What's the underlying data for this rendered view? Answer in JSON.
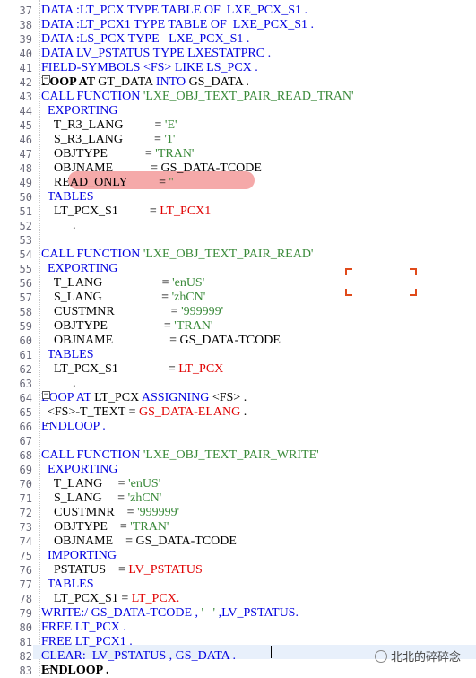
{
  "editor": {
    "lines": [
      {
        "n": "37",
        "tokens": [
          {
            "t": "DATA :LT_PCX TYPE TABLE OF  LXE_PCX_S1 .",
            "c": "bl"
          }
        ]
      },
      {
        "n": "38",
        "tokens": [
          {
            "t": "DATA :LT_PCX1 TYPE TABLE OF  LXE_PCX_S1 .",
            "c": "bl"
          }
        ]
      },
      {
        "n": "39",
        "tokens": [
          {
            "t": "DATA :LS_PCX TYPE   LXE_PCX_S1 .",
            "c": "bl"
          }
        ]
      },
      {
        "n": "40",
        "tokens": [
          {
            "t": "DATA LV_PSTATUS TYPE LXESTATPRC .",
            "c": "bl"
          }
        ]
      },
      {
        "n": "41",
        "tokens": [
          {
            "t": "FIELD-SYMBOLS <FS> LIKE LS_PCX .",
            "c": "bl"
          }
        ]
      },
      {
        "n": "42",
        "tokens": [
          {
            "t": "LOOP AT ",
            "c": "bk"
          },
          {
            "t": "GT_DATA ",
            "c": "plain"
          },
          {
            "t": "INTO ",
            "c": "bl"
          },
          {
            "t": "GS_DATA .",
            "c": "plain"
          }
        ]
      },
      {
        "n": "43",
        "tokens": [
          {
            "t": "CALL FUNCTION ",
            "c": "bl"
          },
          {
            "t": "'LXE_OBJ_TEXT_PAIR_READ_TRAN'",
            "c": "str"
          }
        ]
      },
      {
        "n": "44",
        "tokens": [
          {
            "t": "  EXPORTING",
            "c": "bl"
          }
        ]
      },
      {
        "n": "45",
        "tokens": [
          {
            "t": "    T_R3_LANG          = ",
            "c": "plain"
          },
          {
            "t": "'E'",
            "c": "str"
          }
        ]
      },
      {
        "n": "46",
        "tokens": [
          {
            "t": "    S_R3_LANG          = ",
            "c": "plain"
          },
          {
            "t": "'1'",
            "c": "str"
          }
        ]
      },
      {
        "n": "47",
        "tokens": [
          {
            "t": "    OBJTYPE            = ",
            "c": "plain"
          },
          {
            "t": "'TRAN'",
            "c": "str"
          }
        ]
      },
      {
        "n": "48",
        "tokens": [
          {
            "t": "    OBJNAME            = GS_DATA-TCODE",
            "c": "plain"
          }
        ]
      },
      {
        "n": "49",
        "tokens": [
          {
            "t": "    READ_ONLY          = ",
            "c": "plain"
          },
          {
            "t": "''",
            "c": "str"
          }
        ]
      },
      {
        "n": "50",
        "tokens": [
          {
            "t": "  TABLES",
            "c": "bl"
          }
        ]
      },
      {
        "n": "51",
        "tokens": [
          {
            "t": "    LT_PCX_S1          = ",
            "c": "plain"
          },
          {
            "t": "LT_PCX1",
            "c": "red"
          }
        ]
      },
      {
        "n": "52",
        "tokens": [
          {
            "t": "          .",
            "c": "plain"
          }
        ]
      },
      {
        "n": "53",
        "tokens": []
      },
      {
        "n": "54",
        "tokens": [
          {
            "t": "CALL FUNCTION ",
            "c": "bl"
          },
          {
            "t": "'LXE_OBJ_TEXT_PAIR_READ'",
            "c": "str"
          }
        ]
      },
      {
        "n": "55",
        "tokens": [
          {
            "t": "  EXPORTING",
            "c": "bl"
          }
        ]
      },
      {
        "n": "56",
        "tokens": [
          {
            "t": "    T_LANG                   = ",
            "c": "plain"
          },
          {
            "t": "'enUS'",
            "c": "str"
          }
        ]
      },
      {
        "n": "57",
        "tokens": [
          {
            "t": "    S_LANG                   = ",
            "c": "plain"
          },
          {
            "t": "'zhCN'",
            "c": "str"
          }
        ]
      },
      {
        "n": "58",
        "tokens": [
          {
            "t": "    CUSTMNR                  = ",
            "c": "plain"
          },
          {
            "t": "'999999'",
            "c": "str"
          }
        ]
      },
      {
        "n": "59",
        "tokens": [
          {
            "t": "    OBJTYPE                  = ",
            "c": "plain"
          },
          {
            "t": "'TRAN'",
            "c": "str"
          }
        ]
      },
      {
        "n": "60",
        "tokens": [
          {
            "t": "    OBJNAME                  = GS_DATA-TCODE",
            "c": "plain"
          }
        ]
      },
      {
        "n": "61",
        "tokens": [
          {
            "t": "  TABLES",
            "c": "bl"
          }
        ]
      },
      {
        "n": "62",
        "tokens": [
          {
            "t": "    LT_PCX_S1                = ",
            "c": "plain"
          },
          {
            "t": "LT_PCX",
            "c": "red"
          }
        ]
      },
      {
        "n": "63",
        "tokens": [
          {
            "t": "          .",
            "c": "plain"
          }
        ]
      },
      {
        "n": "64",
        "tokens": [
          {
            "t": "LOOP AT ",
            "c": "bl"
          },
          {
            "t": "LT_PCX ",
            "c": "plain"
          },
          {
            "t": "ASSIGNING ",
            "c": "bl"
          },
          {
            "t": "<FS> .",
            "c": "plain"
          }
        ]
      },
      {
        "n": "65",
        "tokens": [
          {
            "t": "  <FS>-T_TEXT = ",
            "c": "plain"
          },
          {
            "t": "GS_DATA-ELANG",
            "c": "red"
          },
          {
            "t": " .",
            "c": "plain"
          }
        ]
      },
      {
        "n": "66",
        "tokens": [
          {
            "t": "ENDLOOP .",
            "c": "bl"
          }
        ]
      },
      {
        "n": "67",
        "tokens": []
      },
      {
        "n": "68",
        "tokens": [
          {
            "t": "CALL FUNCTION ",
            "c": "bl"
          },
          {
            "t": "'LXE_OBJ_TEXT_PAIR_WRITE'",
            "c": "str"
          }
        ]
      },
      {
        "n": "69",
        "tokens": [
          {
            "t": "  EXPORTING",
            "c": "bl"
          }
        ]
      },
      {
        "n": "70",
        "tokens": [
          {
            "t": "    T_LANG     = ",
            "c": "plain"
          },
          {
            "t": "'enUS'",
            "c": "str"
          }
        ]
      },
      {
        "n": "71",
        "tokens": [
          {
            "t": "    S_LANG     = ",
            "c": "plain"
          },
          {
            "t": "'zhCN'",
            "c": "str"
          }
        ]
      },
      {
        "n": "72",
        "tokens": [
          {
            "t": "    CUSTMNR    = ",
            "c": "plain"
          },
          {
            "t": "'999999'",
            "c": "str"
          }
        ]
      },
      {
        "n": "73",
        "tokens": [
          {
            "t": "    OBJTYPE    = ",
            "c": "plain"
          },
          {
            "t": "'TRAN'",
            "c": "str"
          }
        ]
      },
      {
        "n": "74",
        "tokens": [
          {
            "t": "    OBJNAME    = GS_DATA-TCODE",
            "c": "plain"
          }
        ]
      },
      {
        "n": "75",
        "tokens": [
          {
            "t": "  IMPORTING",
            "c": "bl"
          }
        ]
      },
      {
        "n": "76",
        "tokens": [
          {
            "t": "    PSTATUS    = ",
            "c": "plain"
          },
          {
            "t": "LV_PSTATUS",
            "c": "red"
          }
        ]
      },
      {
        "n": "77",
        "tokens": [
          {
            "t": "  TABLES",
            "c": "bl"
          }
        ]
      },
      {
        "n": "78",
        "tokens": [
          {
            "t": "    LT_PCX_S1 = ",
            "c": "plain"
          },
          {
            "t": "LT_PCX.",
            "c": "red"
          }
        ]
      },
      {
        "n": "79",
        "tokens": [
          {
            "t": "WRITE:/ GS_DATA-TCODE , ",
            "c": "bl"
          },
          {
            "t": "'   '",
            "c": "str"
          },
          {
            "t": " ,LV_PSTATUS.",
            "c": "bl"
          }
        ]
      },
      {
        "n": "80",
        "tokens": [
          {
            "t": "FREE LT_PCX .",
            "c": "bl"
          }
        ]
      },
      {
        "n": "81",
        "tokens": [
          {
            "t": "FREE LT_PCX1 .",
            "c": "bl"
          }
        ]
      },
      {
        "n": "82",
        "tokens": [
          {
            "t": "CLEAR:  LV_PSTATUS , GS_DATA .",
            "c": "bl"
          }
        ]
      },
      {
        "n": "83",
        "tokens": [
          {
            "t": "ENDLOOP .",
            "c": "bk"
          }
        ]
      }
    ]
  },
  "watermark": {
    "text": "北北的碎碎念"
  },
  "colors": {
    "keyword": "#0000e0",
    "string": "#3a8a3a",
    "variable": "#e00000",
    "highlight": "#f39a9a",
    "bracket": "#e04a1a"
  }
}
